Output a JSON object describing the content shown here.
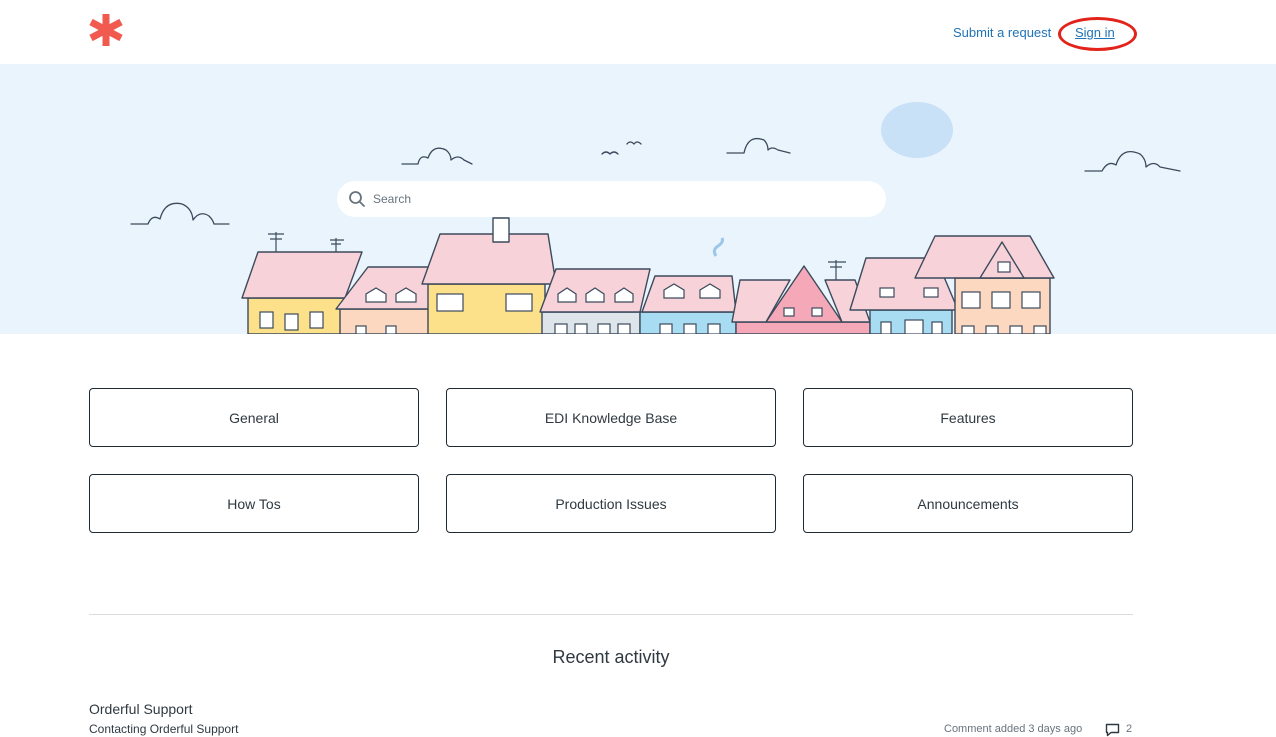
{
  "header": {
    "logo_icon": "asterisk-logo-icon",
    "brand_color": "#f05a4f",
    "submit_request": "Submit a request",
    "sign_in": "Sign in"
  },
  "hero": {
    "search_placeholder": "Search",
    "search_icon": "search-icon",
    "background": "#eaf4fc"
  },
  "categories": [
    {
      "label": "General"
    },
    {
      "label": "EDI Knowledge Base"
    },
    {
      "label": "Features"
    },
    {
      "label": "How Tos"
    },
    {
      "label": "Production Issues"
    },
    {
      "label": "Announcements"
    }
  ],
  "recent_activity": {
    "title": "Recent activity",
    "items": [
      {
        "section": "Orderful Support",
        "article": "Contacting Orderful Support",
        "meta": "Comment added 3 days ago",
        "comment_icon": "comment-icon",
        "comment_count": "2"
      }
    ]
  }
}
